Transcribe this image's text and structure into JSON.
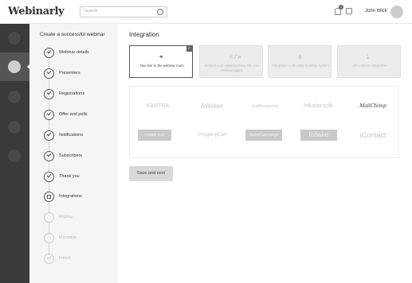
{
  "header": {
    "logo": "Webinarly",
    "search_placeholder": "Search",
    "notification_count": "1",
    "user_name": "John Wick"
  },
  "steps_panel": {
    "title": "Create a successful webinar",
    "steps": [
      {
        "label": "Webinar details",
        "state": "done"
      },
      {
        "label": "Presenters",
        "state": "done"
      },
      {
        "label": "Registrations",
        "state": "done"
      },
      {
        "label": "Offer and polls",
        "state": "done"
      },
      {
        "label": "Notifications",
        "state": "done"
      },
      {
        "label": "Subscribers",
        "state": "done"
      },
      {
        "label": "Thank you",
        "state": "done"
      },
      {
        "label": "Integrations",
        "state": "current"
      },
      {
        "label": "Replay",
        "state": "disabled"
      },
      {
        "label": "Microsite",
        "state": "disabled"
      },
      {
        "label": "Finish",
        "state": "disabled"
      }
    ]
  },
  "main": {
    "title": "Integration",
    "cards": [
      {
        "icon": "link-icon",
        "glyph": "🔗",
        "text": "Your link to the webinar room",
        "selected": true
      },
      {
        "icon": "code-icon",
        "glyph": "</>",
        "text": "Embed your eWebinarNow into you webinar pages",
        "selected": false
      },
      {
        "icon": "share-icon",
        "glyph": "⋖",
        "text": "Integrated a 3D party booking system",
        "selected": false
      },
      {
        "icon": "api-icon",
        "glyph": "⤓",
        "text": "API custom integration",
        "selected": false
      }
    ],
    "services": [
      "KARTRA",
      "AWeber",
      "GetResponse",
      "Infusionsoft.",
      "MailChimp",
      "emace mail",
      "ShoppingCart",
      "ActiveCampaign",
      "listwire",
      "iContact"
    ],
    "save_button": "Save and next"
  },
  "colors": {
    "rail": "#3a3a3a",
    "steps_bg": "#f5f5f5",
    "button_bg": "#d9d9d9"
  }
}
